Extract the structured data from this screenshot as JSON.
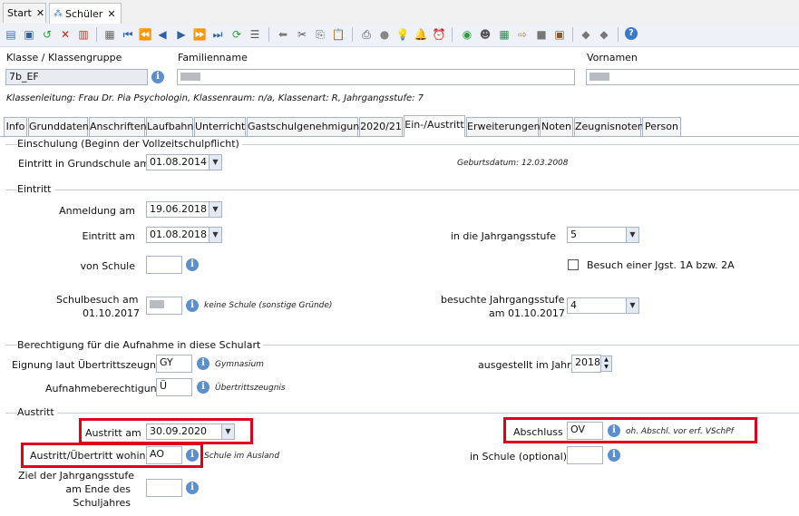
{
  "tabs": {
    "start": "Start",
    "schueler": "Schüler"
  },
  "header": {
    "klasse_label": "Klasse / Klassengruppe",
    "klasse_value": "7b_EF",
    "familienname_label": "Familienname",
    "vornamen_label": "Vornamen",
    "info_line": "Klassenleitung: Frau Dr. Pia Psychologin, Klassenraum: n/a, Klassenart: R, Jahrgangsstufe: 7"
  },
  "content_tabs": [
    "Info",
    "Grunddaten",
    "Anschriften",
    "Laufbahn",
    "Unterricht",
    "Gastschulgenehmigung",
    "2020/21",
    "Ein-/Austritt",
    "Erweiterungen",
    "Noten",
    "Zeugnisnoten",
    "Person"
  ],
  "einschulung": {
    "title": "Einschulung (Beginn der Vollzeitschulpflicht)",
    "eintritt_gs_label": "Eintritt in Grundschule am",
    "eintritt_gs_value": "01.08.2014",
    "geburtsdatum": "Geburtsdatum: 12.03.2008"
  },
  "eintritt": {
    "title": "Eintritt",
    "anmeldung_label": "Anmeldung am",
    "anmeldung_value": "19.06.2018",
    "eintritt_label": "Eintritt am",
    "eintritt_value": "01.08.2018",
    "jgst_label": "in die Jahrgangsstufe",
    "jgst_value": "5",
    "von_schule_label": "von Schule",
    "besuch_label": "Besuch einer Jgst. 1A bzw. 2A",
    "schulbesuch_label_1": "Schulbesuch am",
    "schulbesuch_label_2": "01.10.2017",
    "schulbesuch_note": "keine Schule (sonstige Gründe)",
    "besuchte_label_1": "besuchte Jahrgangsstufe",
    "besuchte_label_2": "am 01.10.2017",
    "besuchte_value": "4"
  },
  "berechtigung": {
    "title": "Berechtigung für die Aufnahme in diese Schulart",
    "eignung_label": "Eignung laut Übertrittszeugnis",
    "eignung_value": "GY",
    "eignung_note": "Gymnasium",
    "ausgestellt_label": "ausgestellt im Jahr",
    "ausgestellt_value": "2018",
    "aufnahme_label": "Aufnahmeberechtigung",
    "aufnahme_value": "Ü",
    "aufnahme_note": "Übertrittszeugnis"
  },
  "austritt": {
    "title": "Austritt",
    "austritt_label": "Austritt am",
    "austritt_value": "30.09.2020",
    "abschluss_label": "Abschluss",
    "abschluss_value": "OV",
    "abschluss_note": "oh. Abschl. vor erf. VSchPf",
    "wohin_label": "Austritt/Übertritt wohin",
    "wohin_value": "AO",
    "wohin_note": "Schule im Ausland",
    "in_schule_label": "in Schule (optional)",
    "ziel_label_1": "Ziel der Jahrgangsstufe",
    "ziel_label_2": "am Ende des",
    "ziel_label_3": "Schuljahres"
  },
  "colors": {
    "highlight": "#e0001b",
    "info_icon": "#5b8fce"
  }
}
